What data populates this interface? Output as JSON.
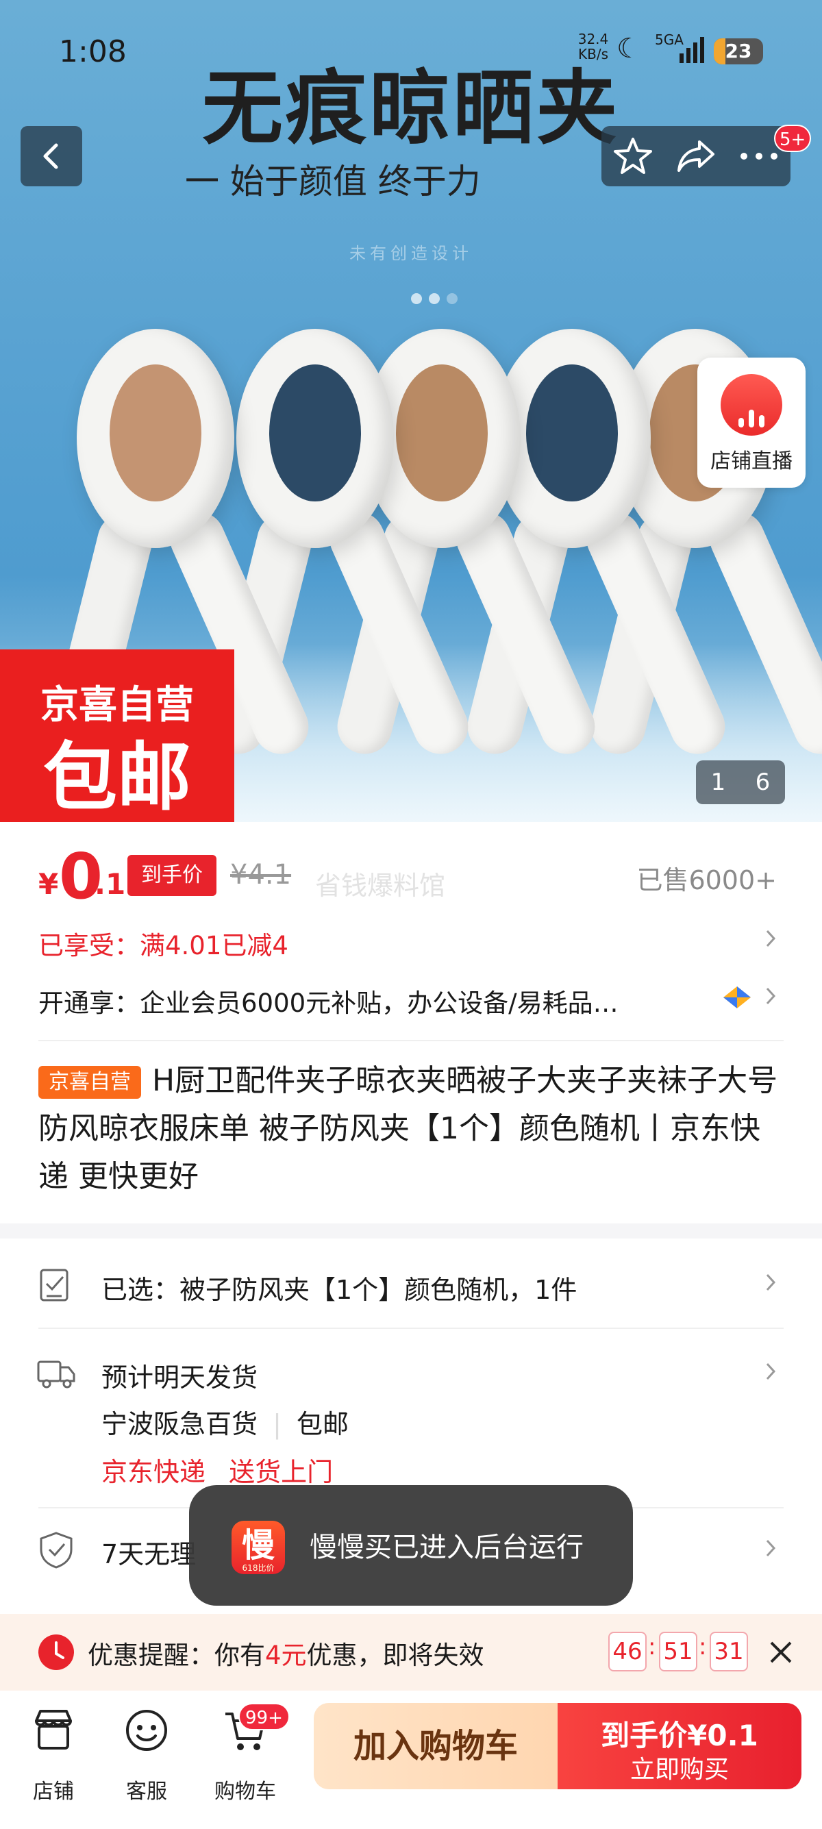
{
  "status_bar": {
    "time": "1:08",
    "network_speed": "32.4",
    "network_unit": "KB/s",
    "network_type": "5GA",
    "battery": "23"
  },
  "hero": {
    "title": "无痕晾晒夹",
    "subtitle": "一   始于颜值 终于力",
    "faint_text": "未有创造设计",
    "promo_line1": "京喜自营",
    "promo_line2": "包邮",
    "image_index": "1",
    "image_total": "6",
    "more_badge": "5+",
    "live_label": "店铺直播"
  },
  "price": {
    "symbol": "¥",
    "integer": "0",
    "decimal": ".1",
    "tag": "到手价",
    "original": "¥4.1",
    "watermark": "省钱爆料馆",
    "sold": "已售6000+"
  },
  "discount_row": "已享受：满4.01已减4",
  "member_row": "开通享：企业会员6000元补贴，办公设备/易耗品…",
  "product": {
    "badge": "京喜自营",
    "title": "H厨卫配件夹子晾衣夹晒被子大夹子夹袜子大号防风晾衣服床单 被子防风夹【1个】颜色随机丨京东快递 更快更好"
  },
  "selected_row": "已选：被子防风夹【1个】颜色随机，1件",
  "shipping": {
    "line1": "预计明天发货",
    "store": "宁波阪急百货",
    "free": "包邮",
    "express": "京东快递",
    "door": "送货上门"
  },
  "return_row": "7天无理",
  "toast": {
    "icon_text": "慢",
    "icon_sub": "618比价",
    "text": "慢慢买已进入后台运行"
  },
  "reminder": {
    "label": "优惠提醒：你有",
    "amount": "4元",
    "suffix": "优惠，即将失效",
    "hours": "46",
    "minutes": "51",
    "seconds": "31"
  },
  "bottom": {
    "store": "店铺",
    "service": "客服",
    "cart": "购物车",
    "cart_badge": "99+",
    "add_cart": "加入购物车",
    "buy_line1": "到手价¥0.1",
    "buy_line2": "立即购买"
  },
  "colors": {
    "accent_red": "#e8232c",
    "orange_badge": "#fa6a1a",
    "hero_blue": "#5aa3d2"
  }
}
